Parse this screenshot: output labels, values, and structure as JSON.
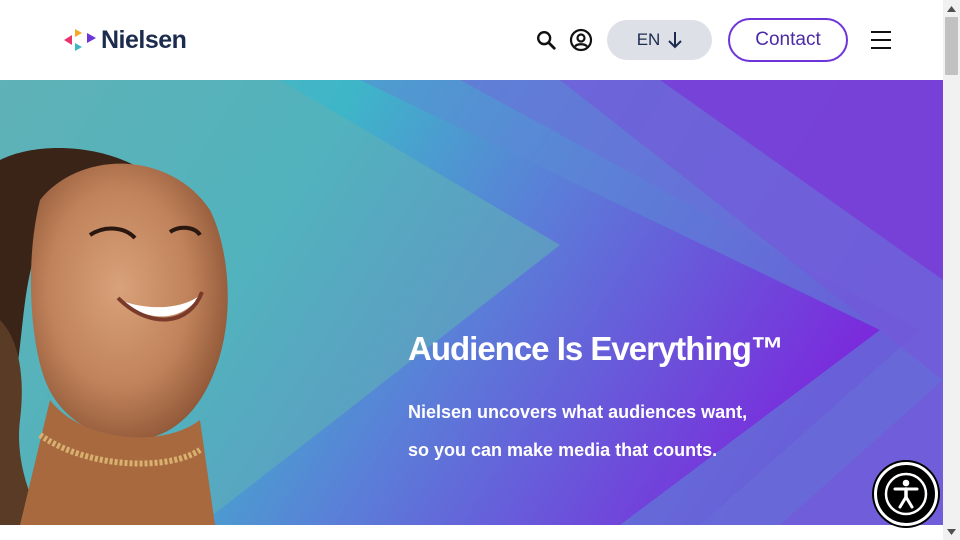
{
  "header": {
    "logo_text": "Nielsen",
    "lang_label": "EN",
    "contact_label": "Contact",
    "icons": {
      "search": "search-icon",
      "account": "account-icon",
      "lang_arrow": "arrow-down-icon",
      "menu": "hamburger-menu-icon"
    }
  },
  "hero": {
    "title": "Audience Is Everything™",
    "subtitle_line1": "Nielsen uncovers what audiences want,",
    "subtitle_line2": "so you can make media that counts."
  },
  "accessibility": {
    "icon": "accessibility-icon"
  },
  "colors": {
    "brand_navy": "#1c2b4e",
    "accent_purple": "#6c35d9",
    "hero_teal": "#3fb6c6",
    "hero_purple": "#7a2bdc"
  }
}
